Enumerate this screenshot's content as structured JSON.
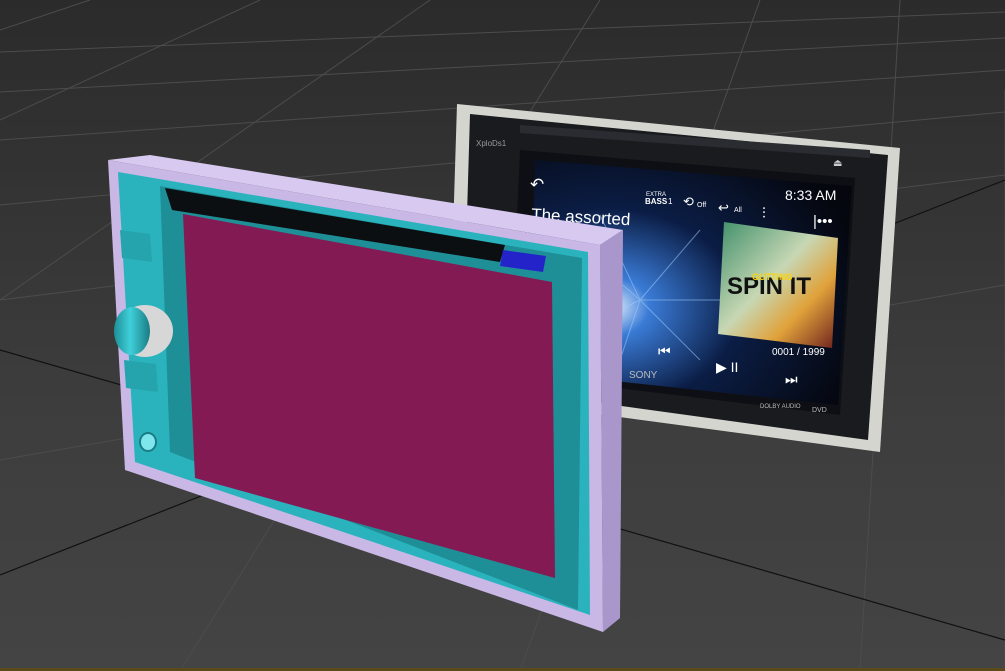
{
  "head_unit_texture": {
    "brand_top_left": "XploDs1",
    "back_glyph": "↶",
    "track_title": "The assorted",
    "extra_bass_line1": "EXTRA",
    "extra_bass_line2": "BASS",
    "extra_bass_value": "1",
    "repeat_label": "Off",
    "shuffle_label": "All",
    "eq_glyph": "⫶",
    "clock": "8:33 AM",
    "menu_glyph": "|•••",
    "eject_glyph": "⏏",
    "album_art_text1": "SPIN IT",
    "album_art_text2": "GUTTING",
    "track_counter": "0001 / 1999",
    "prev_glyph": "⏮",
    "play_pause_glyph": "▶ II",
    "next_glyph": "⏭",
    "brand_bottom": "SONY",
    "footer_badges": "DOLBY AUDIO",
    "dvd_badge": "DVD"
  },
  "colors": {
    "frame_outer": "#c9b7e6",
    "frame_inner": "#2bb3bd",
    "screen": "#831a54",
    "slot_button": "#2323c9"
  }
}
